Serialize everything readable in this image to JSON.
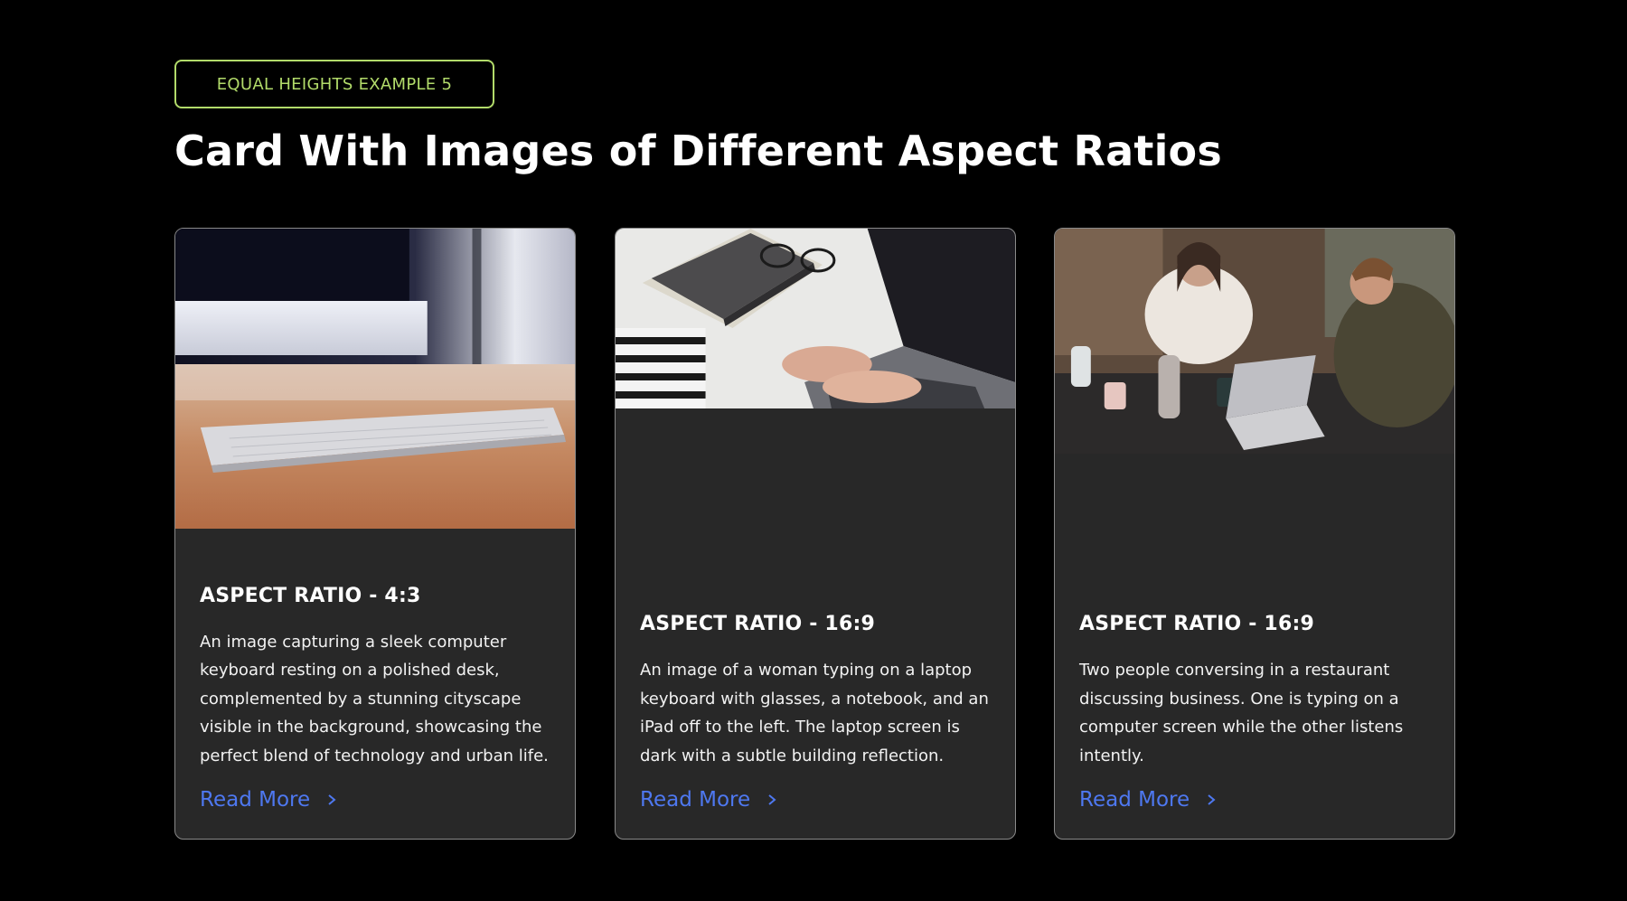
{
  "badge": "EQUAL HEIGHTS EXAMPLE 5",
  "heading": "Card With Images of Different Aspect Ratios",
  "cards": [
    {
      "title": "ASPECT RATIO - 4:3",
      "description": "An image capturing a sleek computer keyboard resting on a polished desk, complemented by a stunning cityscape visible in the background, showcasing the perfect blend of technology and urban life.",
      "link": "Read More",
      "image": "keyboard on desk photo"
    },
    {
      "title": "ASPECT RATIO - 16:9",
      "description": "An image of a woman typing on a laptop keyboard with glasses, a notebook, and an iPad off to the left. The laptop screen is dark with a subtle building reflection.",
      "link": "Read More",
      "image": "woman typing on laptop photo"
    },
    {
      "title": "ASPECT RATIO - 16:9",
      "description": "Two people conversing in a restaurant discussing business. One is typing on a computer screen while the other listens intently.",
      "link": "Read More",
      "image": "two people at restaurant table photo"
    }
  ],
  "colors": {
    "background": "#000000",
    "card": "#282828",
    "accent_green": "#b2db6a",
    "link_blue": "#4e78f0"
  }
}
